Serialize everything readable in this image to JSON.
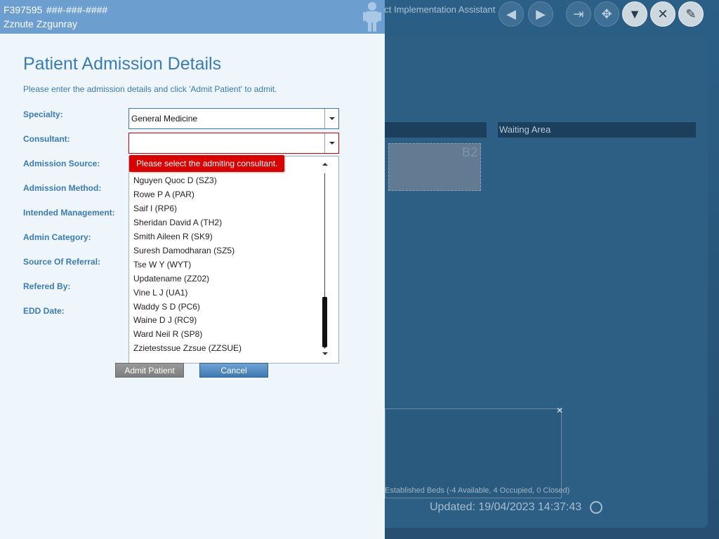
{
  "patient": {
    "id": "F397595",
    "phone": "###-###-####",
    "name": "Zznute Zzgunray"
  },
  "form": {
    "title": "Patient Admission Details",
    "instructions": "Please enter the admission details and click 'Admit Patient' to admit.",
    "labels": {
      "specialty": "Specialty:",
      "consultant": "Consultant:",
      "admission_source": "Admission Source:",
      "admission_method": "Admission Method:",
      "intended_management": "Intended Management:",
      "admin_category": "Admin Category:",
      "source_of_referral": "Source Of Referral:",
      "refered_by": "Refered By:",
      "edd_date": "EDD Date:"
    },
    "specialty_value": "General Medicine",
    "consultant_value": "",
    "consultant_error": "Please select the admiting consultant.",
    "consultant_options": [
      "Nguyen Quoc D (SZ3)",
      "Rowe P A (PAR)",
      "Saif I (RP6)",
      "Sheridan David A (TH2)",
      "Smith Aileen R (SK9)",
      "Suresh Damodharan (SZ5)",
      "Tse W Y (WYT)",
      "Updatename  (ZZ02)",
      "Vine L J (UA1)",
      "Waddy S D (PC6)",
      "Waine D J (RC9)",
      "Ward Neil R (SP8)",
      "Zzietestssue Zzsue (ZZSUE)"
    ],
    "admit_label": "Admit Patient",
    "cancel_label": "Cancel"
  },
  "background": {
    "title_fragment": "ect Implementation Assistant",
    "header_right": "Waiting Area",
    "bed_label": "B2",
    "summary_text": "Established Beds (-4 Available, 4 Occupied, 0 Closed)",
    "updated_text": "Updated: 19/04/2023 14:37:43"
  },
  "colors": {
    "patient_bar": "#6c9fd0",
    "panel": "#eef6fc",
    "accent": "#3b7bb2",
    "error": "#d80000"
  }
}
